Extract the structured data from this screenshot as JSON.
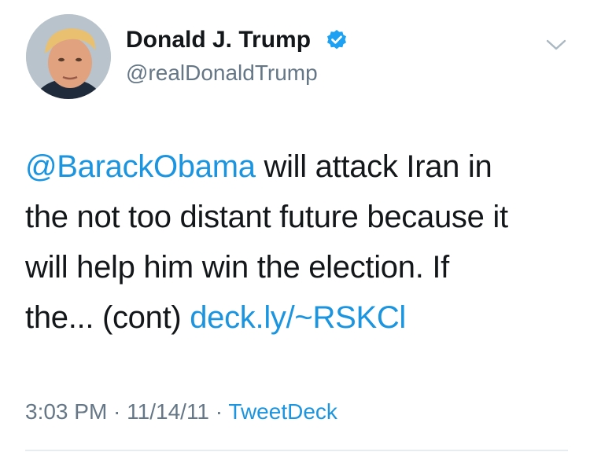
{
  "author": {
    "display_name": "Donald J. Trump",
    "handle": "@realDonaldTrump",
    "verified": true,
    "avatar_icon": "profile-photo"
  },
  "tweet": {
    "mention": "@BarackObama",
    "text_line_1": " will attack Iran in",
    "text_line_2": "the not too distant future because it",
    "text_line_3": "will help him win the election. If",
    "text_line_4": "the... (cont) ",
    "link": "deck.ly/~RSKCl"
  },
  "meta": {
    "time": "3:03 PM",
    "separator": " · ",
    "date": "11/14/11",
    "source": "TweetDeck"
  },
  "icons": {
    "verified": "verified-badge-icon",
    "menu": "chevron-down-icon"
  },
  "colors": {
    "link": "#1b95e0",
    "secondary_text": "#657786",
    "primary_text": "#14171a",
    "verified": "#1da1f2"
  }
}
